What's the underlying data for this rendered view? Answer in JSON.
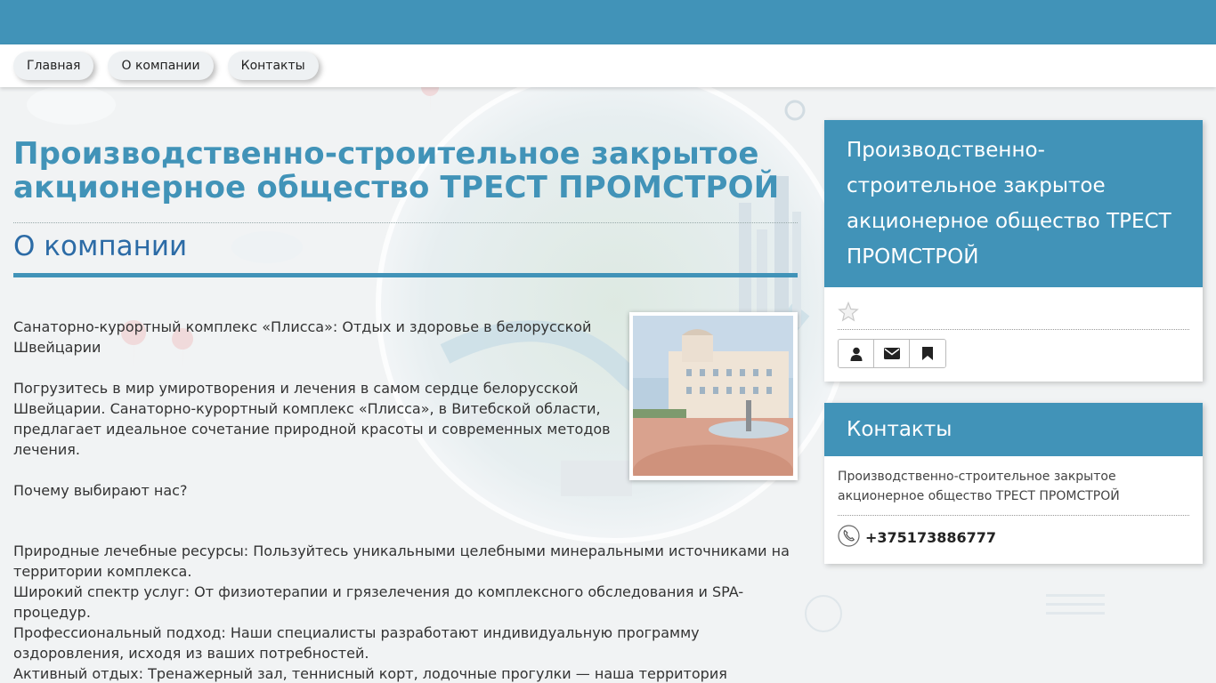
{
  "nav": {
    "items": [
      {
        "label": "Главная"
      },
      {
        "label": "О компании"
      },
      {
        "label": "Контакты"
      }
    ]
  },
  "main": {
    "company_title": "Производственно-строительное закрытое акционерное общество ТРЕСТ ПРОМСТРОЙ",
    "section_title": "О компании",
    "paragraphs": {
      "p1": "Санаторно-курортный комплекс «Плисса»: Отдых и здоровье в белорусской Швейцарии",
      "p2": "Погрузитесь в мир умиротворения и лечения в самом сердце белорусской Швейцарии. Санаторно-курортный комплекс «Плисса», в Витебской области, предлагает идеальное сочетание природной красоты и современных методов лечения.",
      "p3": "Почему выбирают нас?"
    },
    "features": [
      "Природные лечебные ресурсы: Пользуйтесь уникальными целебными минеральными источниками на территории комплекса.",
      "Широкий спектр услуг: От физиотерапии и грязелечения до комплексного обследования и SPA-процедур.",
      "Профессиональный подход: Наши специалисты разработают индивидуальную программу оздоровления, исходя из ваших потребностей.",
      "Активный отдых: Тренажерный зал, теннисный корт, лодочные прогулки — наша территория"
    ]
  },
  "sidebar": {
    "company_card_title": "Производственно-строительное закрытое акционерное общество ТРЕСТ ПРОМСТРОЙ",
    "contacts_title": "Контакты",
    "contact_company": "Производственно-строительное закрытое акционерное общество ТРЕСТ ПРОМСТРОЙ",
    "phone": "+375173886777",
    "icons": [
      "star-icon",
      "user-icon",
      "envelope-icon",
      "bookmark-icon",
      "phone-icon"
    ]
  },
  "colors": {
    "brand": "#4193b8",
    "heading_blue": "#2c6ba6"
  }
}
